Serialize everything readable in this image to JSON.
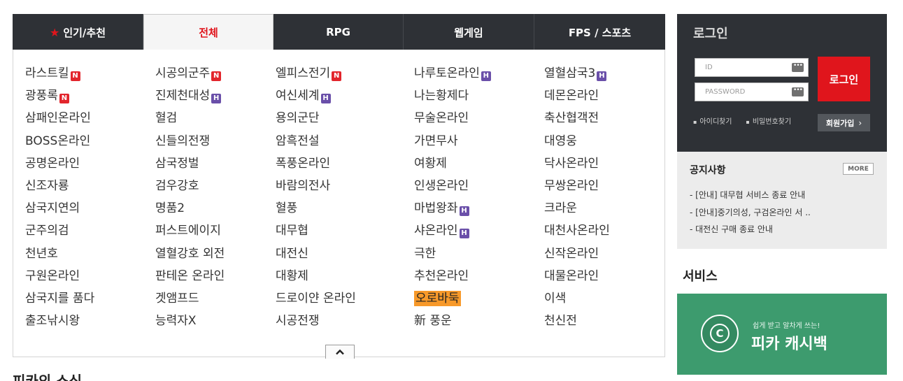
{
  "tabs": [
    {
      "label": "인기/추천",
      "icon": "star-icon"
    },
    {
      "label": "전체",
      "active": true
    },
    {
      "label": "RPG"
    },
    {
      "label": "웹게임"
    },
    {
      "label": "FPS / 스포츠"
    }
  ],
  "games": [
    [
      {
        "name": "라스트킬",
        "badge": "N"
      },
      {
        "name": "광풍록",
        "badge": "N"
      },
      {
        "name": "삼패인온라인"
      },
      {
        "name": "BOSS온라인"
      },
      {
        "name": "공명온라인"
      },
      {
        "name": "신조자룡"
      },
      {
        "name": "삼국지연의"
      },
      {
        "name": "군주의검"
      },
      {
        "name": "천년호"
      },
      {
        "name": "구원온라인"
      },
      {
        "name": "삼국지를 품다"
      },
      {
        "name": "출조낚시왕"
      }
    ],
    [
      {
        "name": "시공의군주",
        "badge": "N"
      },
      {
        "name": "진제천대성",
        "badge": "H"
      },
      {
        "name": "혈검"
      },
      {
        "name": "신들의전쟁"
      },
      {
        "name": "삼국정벌"
      },
      {
        "name": "검우강호"
      },
      {
        "name": "명품2"
      },
      {
        "name": "퍼스트에이지"
      },
      {
        "name": "열혈강호 외전"
      },
      {
        "name": "판테온 온라인"
      },
      {
        "name": "겟앰프드"
      },
      {
        "name": "능력자X"
      }
    ],
    [
      {
        "name": "엘피스전기",
        "badge": "N"
      },
      {
        "name": "여신세계",
        "badge": "H"
      },
      {
        "name": "용의군단"
      },
      {
        "name": "암흑전설"
      },
      {
        "name": "폭풍온라인"
      },
      {
        "name": "바람의전사"
      },
      {
        "name": "혈풍"
      },
      {
        "name": "대무협"
      },
      {
        "name": "대전신"
      },
      {
        "name": "대황제"
      },
      {
        "name": "드로이얀 온라인"
      },
      {
        "name": "시공전쟁"
      }
    ],
    [
      {
        "name": "나루토온라인",
        "badge": "H"
      },
      {
        "name": "나는황제다"
      },
      {
        "name": "무술온라인"
      },
      {
        "name": "가면무사"
      },
      {
        "name": "여황제"
      },
      {
        "name": "인생온라인"
      },
      {
        "name": "마법왕좌",
        "badge": "H"
      },
      {
        "name": "샤온라인",
        "badge": "H"
      },
      {
        "name": "극한"
      },
      {
        "name": "추천온라인"
      },
      {
        "name": "오로바둑",
        "highlight": true
      },
      {
        "name": "新 풍운"
      }
    ],
    [
      {
        "name": "열혈삼국3",
        "badge": "H"
      },
      {
        "name": "데몬온라인"
      },
      {
        "name": "축산협객전"
      },
      {
        "name": "대영웅"
      },
      {
        "name": "닥사온라인"
      },
      {
        "name": "무쌍온라인"
      },
      {
        "name": "크라운"
      },
      {
        "name": "대천사온라인"
      },
      {
        "name": "신작온라인"
      },
      {
        "name": "대물온라인"
      },
      {
        "name": "이색"
      },
      {
        "name": "천신전"
      }
    ]
  ],
  "section_cut_label": "피카의 소식",
  "login": {
    "title": "로그인",
    "id_placeholder": "ID",
    "pw_placeholder": "PASSWORD",
    "login_button": "로그인",
    "find_id": "아이디찾기",
    "find_pw": "비밀번호찾기",
    "join": "회원가입"
  },
  "notice": {
    "title": "공지사항",
    "more": "MORE",
    "items": [
      "- [안내] 대무협 서비스 종료 안내",
      "- [안내]중기의성, 구검온라인 서 ..",
      "- 대전신 구매 종료 안내"
    ]
  },
  "service": {
    "title": "서비스",
    "banner_sub": "쉽게 받고 알차게 쓰는!",
    "banner_main": "피카 캐시백",
    "coin_letter": "C"
  },
  "colors": {
    "tab_bg": "#2e3136",
    "accent_red": "#e0151c",
    "badge_new": "#e2252c",
    "badge_hot": "#6a4fa9",
    "highlight": "#f7992a",
    "banner_green": "#3d9b6e"
  }
}
